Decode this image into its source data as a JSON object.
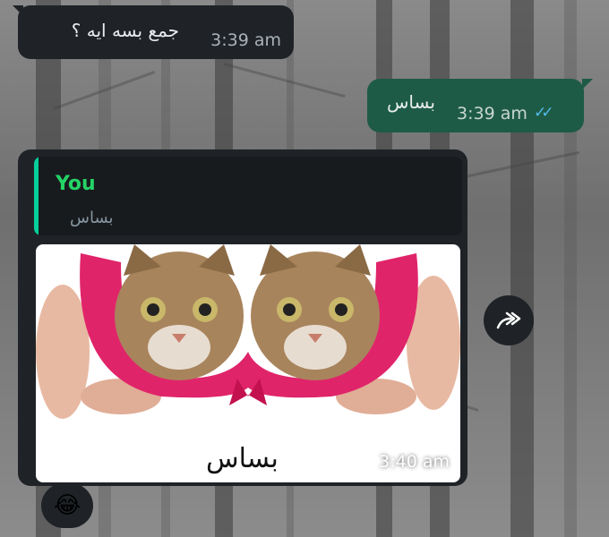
{
  "messages": [
    {
      "direction": "incoming",
      "text": "جمع بسه ايه ؟",
      "time": "3:39 am"
    },
    {
      "direction": "outgoing",
      "text": "بساس",
      "time": "3:39 am",
      "ticks": "✓✓"
    },
    {
      "direction": "incoming",
      "reply": {
        "author": "You",
        "text": "بساس"
      },
      "caption": "بساس",
      "time": "3:40 am",
      "image": "two cat faces in pink bra held by hands"
    }
  ],
  "forward_icon": "forward-icon",
  "reaction": {
    "emoji": "😂",
    "icon": "laughing-emoji-icon"
  },
  "colors": {
    "incoming": "#1f2327",
    "outgoing": "#1e5b46",
    "reply_name": "#25d366",
    "read_ticks": "#53bdeb"
  }
}
